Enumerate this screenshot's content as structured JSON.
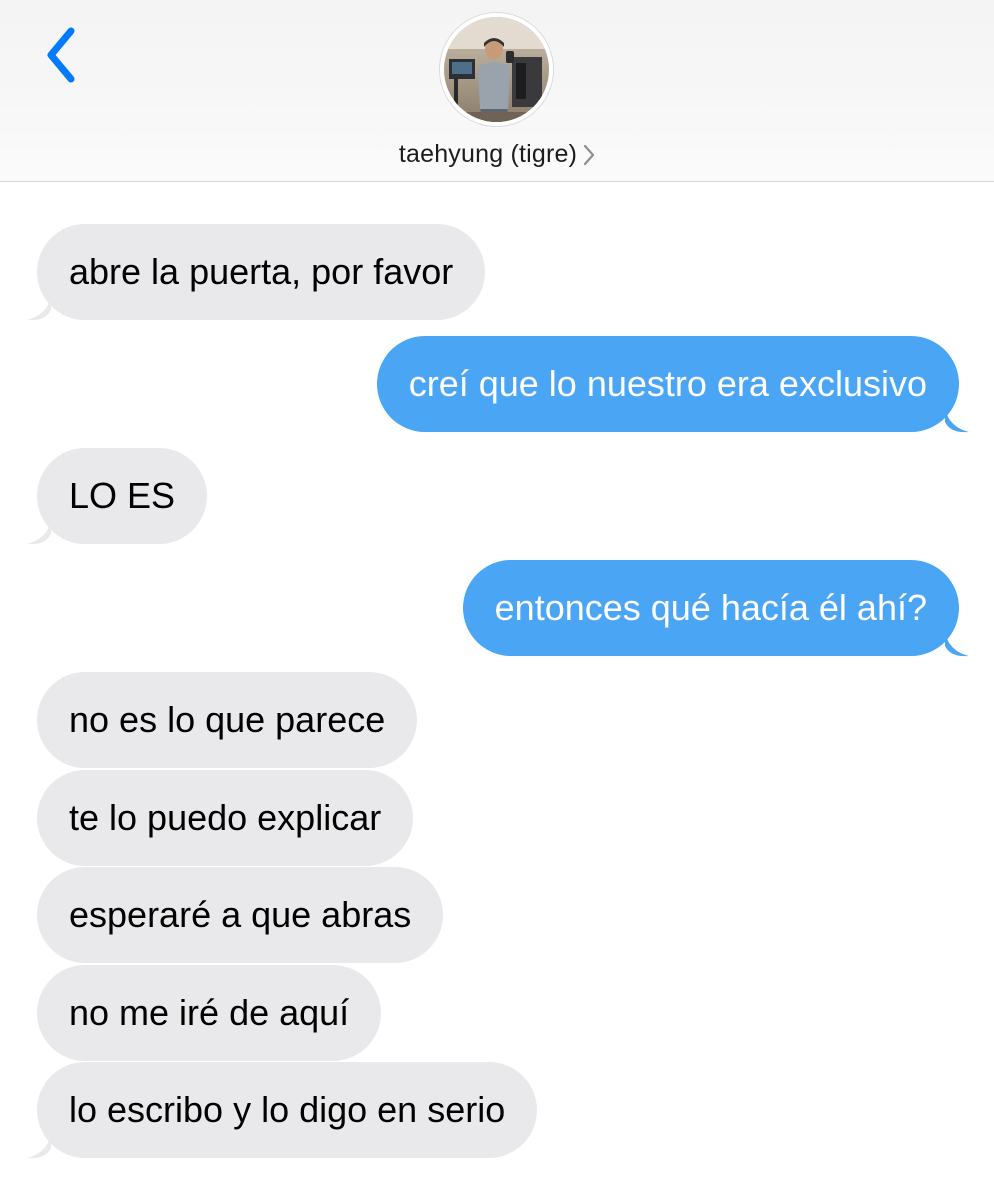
{
  "header": {
    "contact_name": "taehyung (tigre)",
    "accent_color": "#007aff"
  },
  "icons": {
    "back": "chevron-left-icon",
    "contact_more": "chevron-right-icon",
    "avatar": "contact-photo"
  },
  "colors": {
    "received_bubble": "#e9e9eb",
    "sent_bubble": "#4ba5f5"
  },
  "messages": [
    {
      "sender": "contact",
      "text": "abre la puerta, por favor"
    },
    {
      "sender": "me",
      "text": "creí que lo nuestro era exclusivo"
    },
    {
      "sender": "contact",
      "text": "LO ES"
    },
    {
      "sender": "me",
      "text": "entonces qué hacía él ahí?"
    },
    {
      "sender": "contact",
      "text": "no es lo que parece"
    },
    {
      "sender": "contact",
      "text": "te lo puedo explicar"
    },
    {
      "sender": "contact",
      "text": "esperaré a que abras"
    },
    {
      "sender": "contact",
      "text": "no me iré de aquí"
    },
    {
      "sender": "contact",
      "text": "lo escribo y lo digo en serio"
    }
  ]
}
